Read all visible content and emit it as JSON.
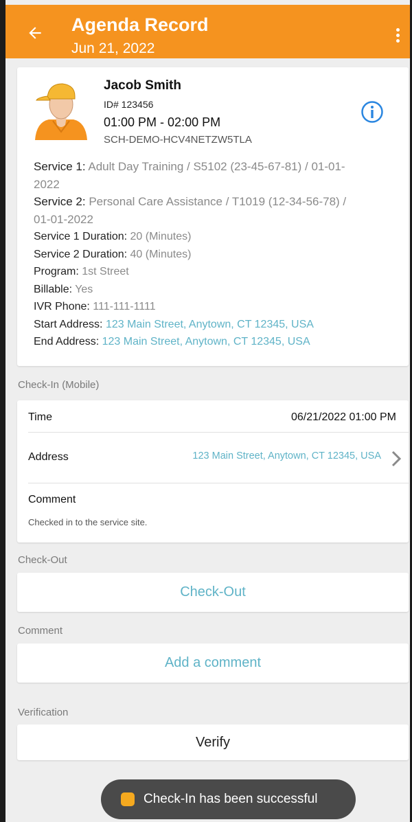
{
  "header": {
    "title": "Agenda Record",
    "date": "Jun 21, 2022"
  },
  "client": {
    "name": "Jacob Smith",
    "id": "ID# 123456",
    "time": "01:00 PM - 02:00 PM",
    "schedule_code": "SCH-DEMO-HCV4NETZW5TLA"
  },
  "details": {
    "service1_label": "Service 1:",
    "service1_value": "Adult Day Training / S5102 (23-45-67-81) / 01-01-2022",
    "service2_label": "Service 2:",
    "service2_value": "Personal Care Assistance / T1019 (12-34-56-78) / 01-01-2022",
    "s1dur_label": "Service 1 Duration:",
    "s1dur_value": "20 (Minutes)",
    "s2dur_label": "Service 2 Duration:",
    "s2dur_value": "40 (Minutes)",
    "program_label": "Program:",
    "program_value": "1st Street",
    "billable_label": "Billable:",
    "billable_value": "Yes",
    "ivr_label": "IVR Phone:",
    "ivr_value": "111-111-1111",
    "start_label": "Start Address:",
    "start_value": "123 Main Street, Anytown, CT 12345, USA",
    "end_label": "End Address:",
    "end_value": "123 Main Street, Anytown, CT 12345, USA"
  },
  "checkin": {
    "section_label": "Check-In (Mobile)",
    "time_label": "Time",
    "time_value": "06/21/2022 01:00 PM",
    "address_label": "Address",
    "address_value": "123 Main Street, Anytown, CT 12345, USA",
    "comment_label": "Comment",
    "comment_value": "Checked in to the service site."
  },
  "checkout": {
    "section_label": "Check-Out",
    "button_label": "Check-Out"
  },
  "comment": {
    "section_label": "Comment",
    "button_label": "Add a comment"
  },
  "verification": {
    "section_label": "Verification",
    "button_label": "Verify"
  },
  "toast": {
    "message": "Check-In has been successful"
  },
  "colors": {
    "brand": "#f5931f",
    "link": "#5fb3c7"
  }
}
